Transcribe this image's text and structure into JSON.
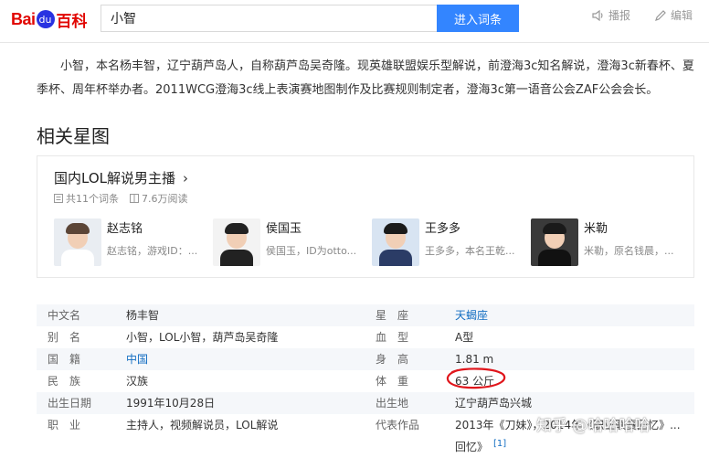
{
  "header": {
    "logo_text": "Bai",
    "logo_paw": "du",
    "logo_baike": "百科",
    "search_value": "小智",
    "enter_button": "进入词条",
    "broadcast": "播报",
    "edit": "编辑"
  },
  "intro": "小智，本名杨丰智，辽宁葫芦岛人，自称葫芦岛吴奇隆。现英雄联盟娱乐型解说，前澄海3c知名解说，澄海3c新春杯、夏季杯、周年杯举办者。2011WCG澄海3c线上表演赛地图制作及比赛规则制定者，澄海3c第一语音公会ZAF公会会长。",
  "section_title": "相关星图",
  "card": {
    "title": "国内LOL解说男主播",
    "chevron": "›",
    "entry_count": "共11个词条",
    "reads": "7.6万阅读",
    "persons": [
      {
        "name": "赵志铭",
        "desc": "赵志铭，游戏ID：...",
        "hair": "#5b4537",
        "body": "#ffffff",
        "bg": "#e9edf2"
      },
      {
        "name": "侯国玉",
        "desc": "侯国玉，ID为otto...",
        "hair": "#222222",
        "body": "#222222",
        "bg": "#f3f3f3"
      },
      {
        "name": "王多多",
        "desc": "王多多，本名王乾...",
        "hair": "#1a1a1a",
        "body": "#2b3c66",
        "bg": "#d8e4f2"
      },
      {
        "name": "米勒",
        "desc": "米勒，原名钱晨，...",
        "hair": "#1a1a1a",
        "body": "#111111",
        "bg": "#3a3a3a"
      }
    ]
  },
  "info": [
    {
      "k1": "中文名",
      "v1": "杨丰智",
      "k2": "星　座",
      "v2": "天蝎座",
      "v2_link": true
    },
    {
      "k1": "别　名",
      "v1": "小智，LOL小智，葫芦岛吴奇隆",
      "k2": "血　型",
      "v2": "A型"
    },
    {
      "k1": "国　籍",
      "v1": "中国",
      "v1_link": true,
      "k2": "身　高",
      "v2": "1.81 m"
    },
    {
      "k1": "民　族",
      "v1": "汉族",
      "k2": "体　重",
      "v2": "63 公斤"
    },
    {
      "k1": "出生日期",
      "v1": "1991年10月28日",
      "k2": "出生地",
      "v2": "辽宁葫芦岛兴城"
    },
    {
      "k1": "职　业",
      "v1": "主持人，视频解说员，LOL解说",
      "k2": "代表作品",
      "v2": "2013年《刀妹》，2014年《职业联赛回忆》..."
    }
  ],
  "info_extra": {
    "line2": "回忆》",
    "ref": "[1]"
  },
  "watermark": "知乎 @哈哈哈哈",
  "colors": {
    "accent": "#3385ff",
    "link": "#136ec2",
    "brand_red": "#e10602",
    "annotation": "#e0161c"
  }
}
